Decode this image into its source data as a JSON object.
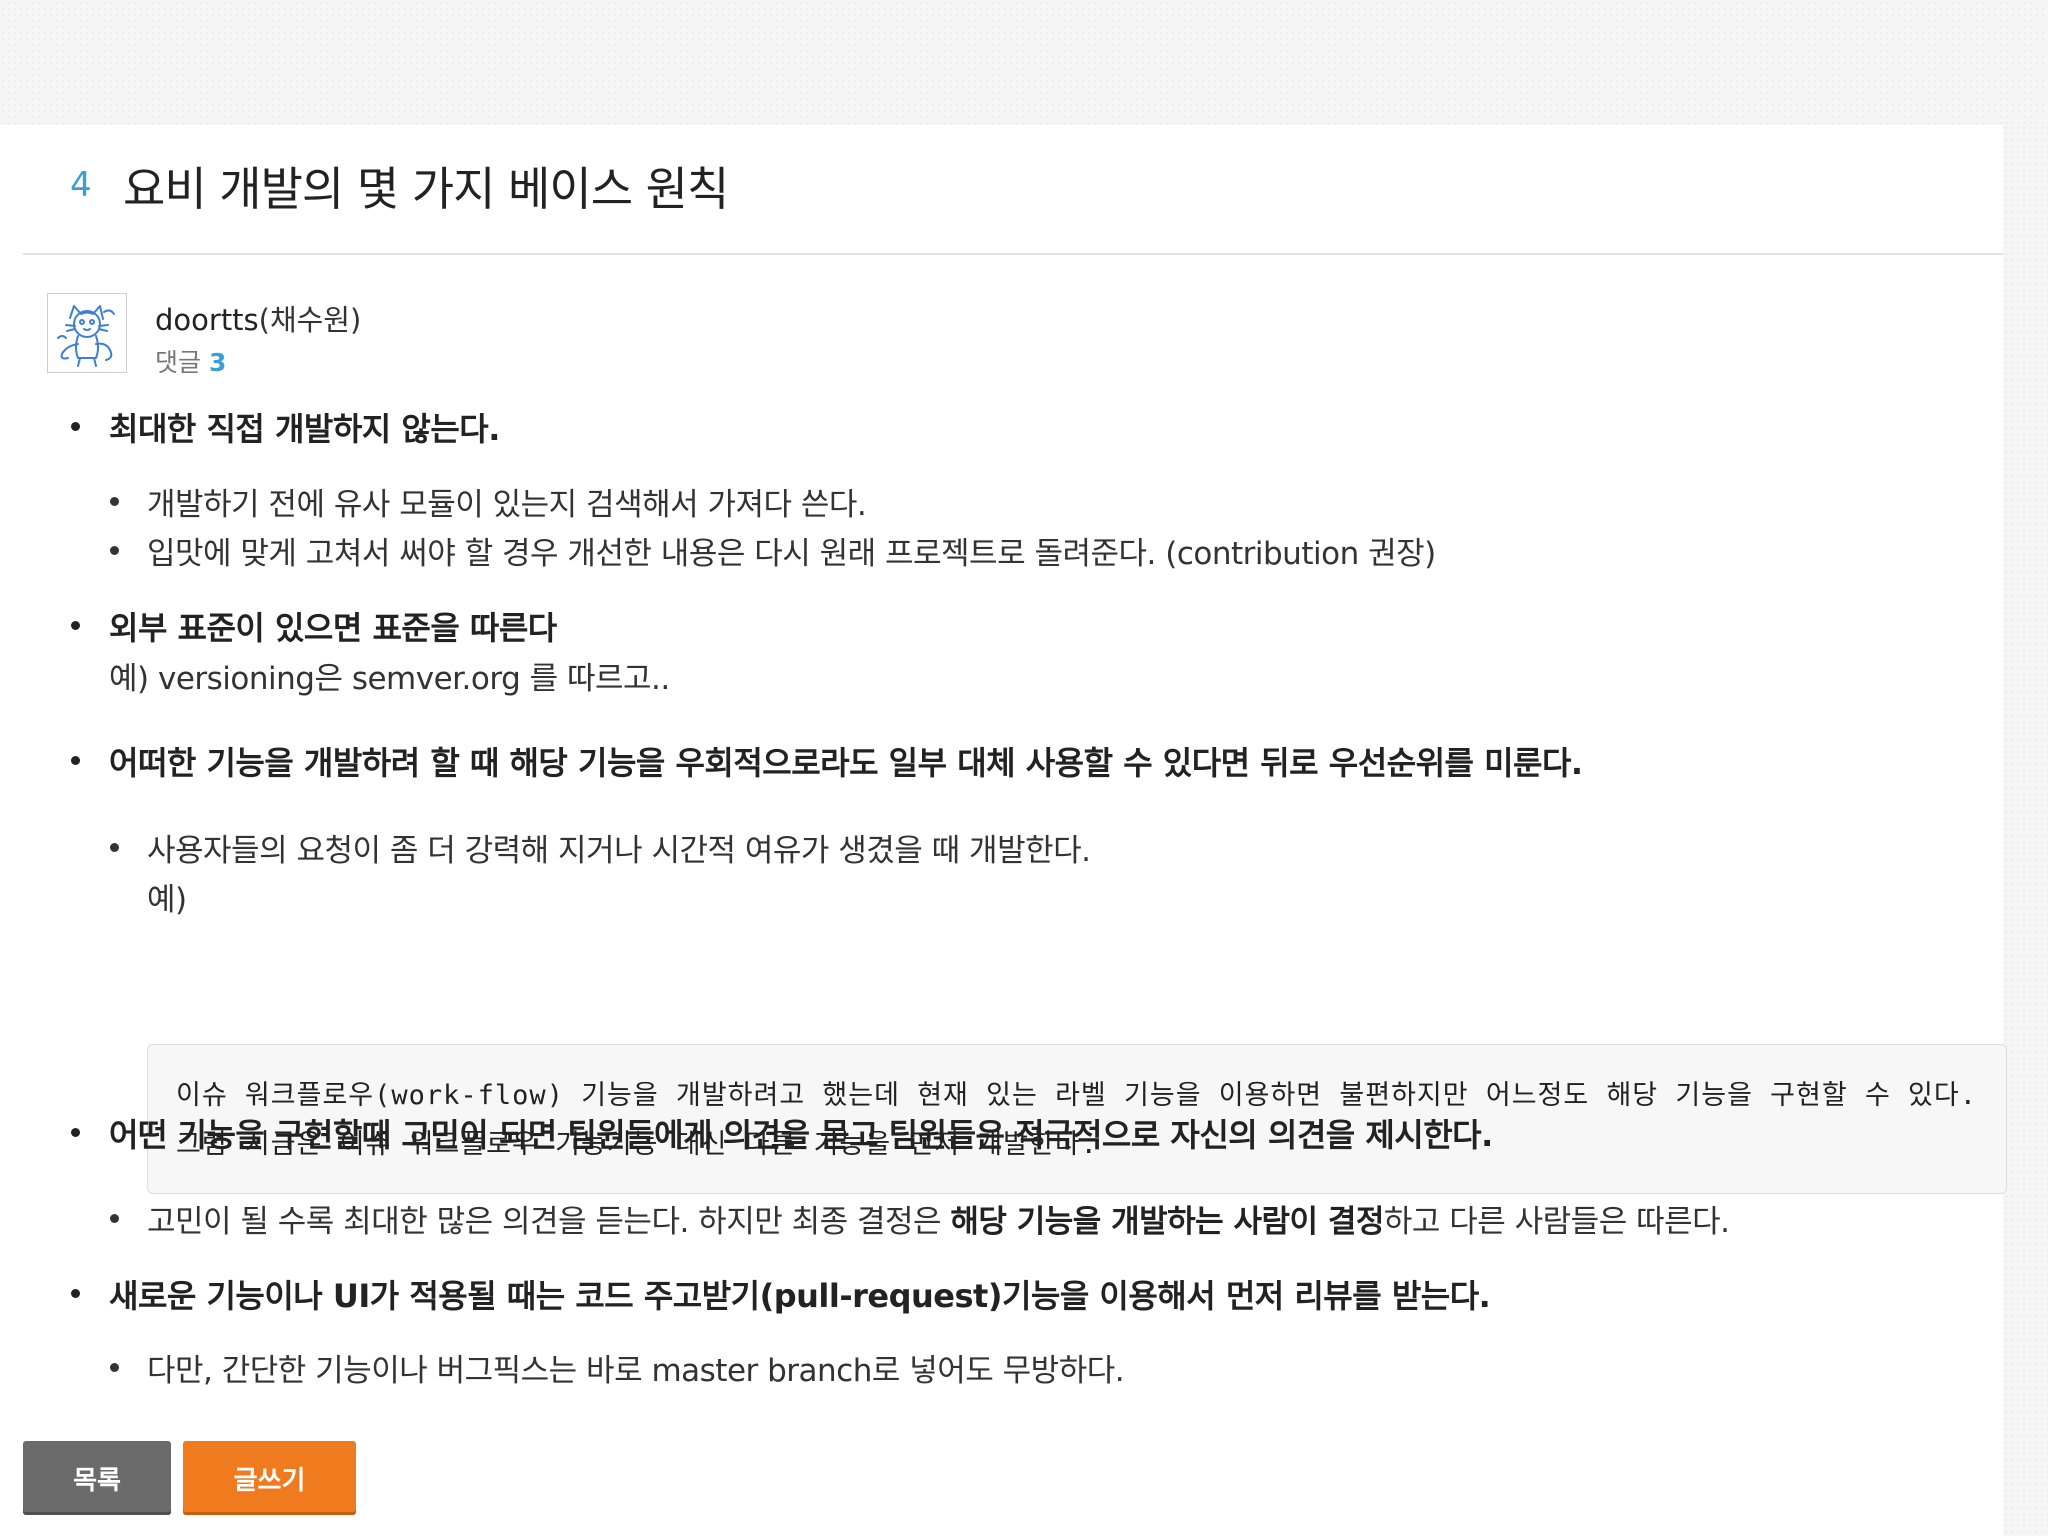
{
  "post": {
    "number": "4",
    "title": "요비 개발의 몇 가지 베이스 원칙",
    "author": {
      "username": "doortts",
      "realname": "(채수원)",
      "avatar_icon": "cat-drawing-avatar"
    },
    "comments": {
      "label": "댓글",
      "count": "3"
    }
  },
  "content": {
    "item1": {
      "heading": "최대한 직접 개발하지 않는다.",
      "sub1": "개발하기 전에 유사 모듈이 있는지 검색해서 가져다 쓴다.",
      "sub2": "입맛에 맞게 고쳐서 써야 할 경우 개선한 내용은 다시 원래 프로젝트로 돌려준다. (contribution 권장)"
    },
    "item2": {
      "heading": "외부 표준이 있으면 표준을 따른다",
      "example": "예) versioning은 semver.org 를 따르고.."
    },
    "item3": {
      "heading": "어떠한 기능을 개발하려 할 때 해당 기능을 우회적으로라도 일부 대체 사용할 수 있다면 뒤로 우선순위를 미룬다.",
      "sub1": "사용자들의 요청이 좀 더 강력해 지거나 시간적 여유가 생겼을 때 개발한다.",
      "sub1_example": "예)",
      "code_line1": "이슈 워크플로우(work-flow) 기능을 개발하려고 했는데 현재 있는 라벨 기능을 이용하면 불편하지만 어느정도 해당 기능을 구현할 수 있다.",
      "code_line2": "그럼 지금은 이슈 워크플로우 기능기능 대신 다른 기능을 먼저 개발한다."
    },
    "item4": {
      "heading": "어떤 기능을 구현할때 고민이 되면 팀원들에게 의견을 묻고 팀원들은 적극적으로 자신의 의견을 제시한다.",
      "sub1_pre": "고민이 될 수록 최대한 많은 의견을 듣는다. 하지만 최종 결정은 ",
      "sub1_bold": "해당 기능을 개발하는 사람이 결정",
      "sub1_post": "하고 다른 사람들은 따른다."
    },
    "item5": {
      "heading": "새로운 기능이나 UI가 적용될 때는 코드 주고받기(pull-request)기능을 이용해서 먼저 리뷰를 받는다.",
      "sub1": "다만, 간단한 기능이나 버그픽스는 바로 master branch로 넣어도 무방하다."
    }
  },
  "buttons": {
    "list_label": "목록",
    "write_label": "글쓰기",
    "list_color": "#6b6b6b",
    "write_color": "#f07a1e"
  },
  "colors": {
    "accent": "#3a9fd6"
  }
}
